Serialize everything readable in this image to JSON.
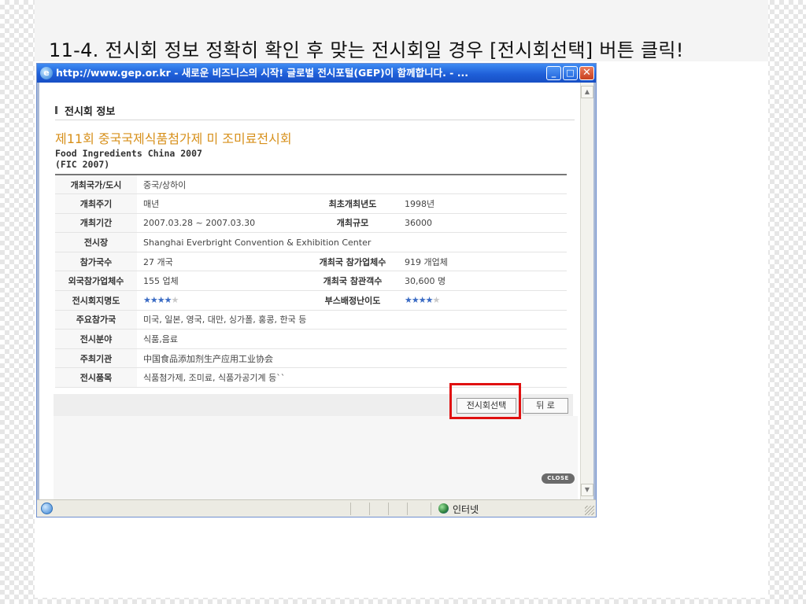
{
  "slide": {
    "title": "11-4. 전시회 정보 정확히 확인 후 맞는 전시회일 경우 [전시회선택] 버튼 클릭!"
  },
  "window": {
    "title": "http://www.gep.or.kr - 새로운 비즈니스의 시작! 글로벌 전시포털(GEP)이 함께합니다. - ...",
    "icons": [
      "ie-page-icon",
      "minimize-icon",
      "maximize-icon",
      "close-icon"
    ]
  },
  "content": {
    "section_title": "전시회 정보",
    "event_name_kr": "제11회 중국국제식품첨가제 미 조미료전시회",
    "event_name_en_line1": "Food Ingredients China 2007",
    "event_name_en_line2": "(FIC 2007)",
    "rows": [
      {
        "label": "개최국가/도시",
        "value": "중국/상하이"
      },
      {
        "label": "개최주기",
        "value": "매년",
        "label2": "최초개최년도",
        "value2": "1998년"
      },
      {
        "label": "개최기간",
        "value": "2007.03.28 ~ 2007.03.30",
        "label2": "개최규모",
        "value2": "36000"
      },
      {
        "label": "전시장",
        "value": "Shanghai Everbright Convention & Exhibition Center"
      },
      {
        "label": "참가국수",
        "value": "27 개국",
        "label2": "개최국 참가업체수",
        "value2": "919 개업체"
      },
      {
        "label": "외국참가업체수",
        "value": "155 업체",
        "label2": "개최국 참관객수",
        "value2": "30,600 명"
      },
      {
        "label": "전시회지명도",
        "stars": 4,
        "label2": "부스배정난이도",
        "stars2": 4
      },
      {
        "label": "주요참가국",
        "value": "미국, 일본, 영국, 대만, 싱가폴, 홍콩, 한국 등"
      },
      {
        "label": "전시분야",
        "value": "식품,음료"
      },
      {
        "label": "주최기관",
        "value": "中国食品添加剂生产应用工业协会"
      },
      {
        "label": "전시품목",
        "value": "식품첨가제, 조미료, 식품가공기계 등``"
      }
    ],
    "star_max": 5,
    "select_button": "전시회선택",
    "back_button": "뒤 로",
    "close_pill": "CLOSE"
  },
  "statusbar": {
    "zone": "인터넷"
  },
  "colors": {
    "titlebar": "#1f5fd9",
    "event_name": "#d7901b",
    "highlight": "#e01010",
    "star_on": "#3a6bc4"
  }
}
